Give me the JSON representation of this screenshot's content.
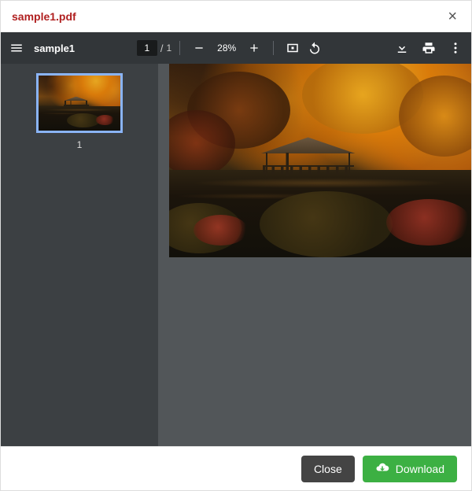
{
  "modal": {
    "title": "sample1.pdf",
    "close_glyph": "×"
  },
  "toolbar": {
    "doc_name": "sample1",
    "page_current": "1",
    "page_separator": "/",
    "page_total": "1",
    "zoom_level": "28%"
  },
  "thumbnail": {
    "page_number": "1"
  },
  "footer": {
    "close_label": "Close",
    "download_label": "Download"
  }
}
